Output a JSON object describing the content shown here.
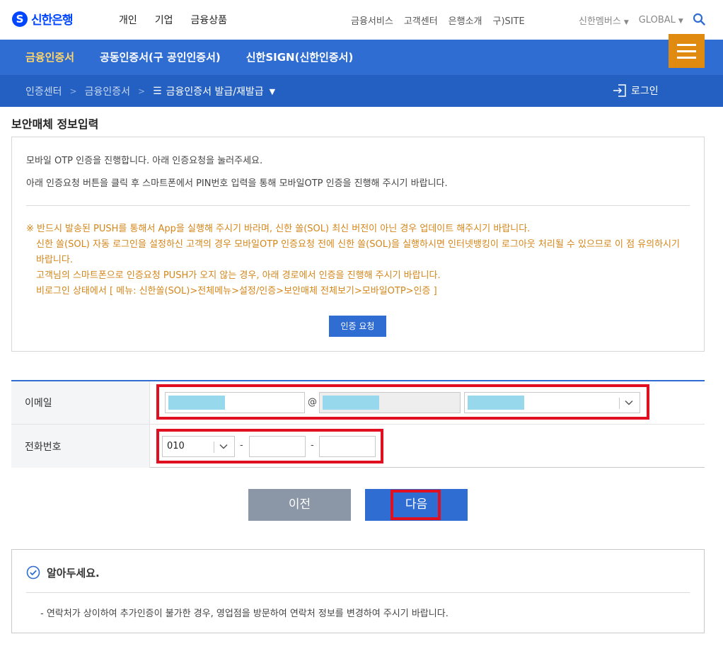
{
  "header": {
    "logo_mark": "S",
    "logo_text": "신한은행",
    "main_nav": [
      "개인",
      "기업",
      "금융상품"
    ],
    "util_nav": [
      "금융서비스",
      "고객센터",
      "은행소개",
      "구)SITE"
    ],
    "right_nav": [
      "신한멤버스",
      "GLOBAL"
    ]
  },
  "tabs": [
    "금융인증서",
    "공동인증서(구 공인인증서)",
    "신한SIGN(신한인증서)"
  ],
  "breadcrumb": {
    "items": [
      "인증센터",
      "금융인증서"
    ],
    "current": "금융인증서 발급/재발급",
    "login": "로그인"
  },
  "section_title": "보안매체 정보입력",
  "info": {
    "line1": "모바일 OTP 인증을 진행합니다. 아래 인증요청을 눌러주세요.",
    "line2": "아래 인증요청 버튼을 클릭 후 스마트폰에서 PIN번호 입력을 통해 모바일OTP 인증을 진행해 주시기 바랍니다.",
    "warn1": "※ 반드시 발송된 PUSH를 통해서 App을 실행해 주시기 바라며, 신한 쏠(SOL) 최신 버전이 아닌 경우 업데이트 해주시기 바랍니다.",
    "warn2": "신한 쏠(SOL) 자동 로그인을 설정하신 고객의 경우 모바일OTP 인증요청 전에 신한 쏠(SOL)을 실행하시면 인터넷뱅킹이 로그아웃 처리될 수 있으므로 이 점 유의하시기 바랍니다.",
    "warn3": "고객님의 스마트폰으로 인증요청 PUSH가 오지 않는 경우, 아래 경로에서 인증을 진행해 주시기 바랍니다.",
    "warn4": "비로그인 상태에서 [ 메뉴: 신한쏠(SOL)>전체메뉴>설정/인증>보안매체 전체보기>모바일OTP>인증 ]",
    "request_button": "인증 요청"
  },
  "form": {
    "email_label": "이메일",
    "at_sign": "@",
    "phone_label": "전화번호",
    "phone_prefix": "010",
    "dash": "-"
  },
  "buttons": {
    "prev": "이전",
    "next": "다음"
  },
  "notice": {
    "title": "알아두세요.",
    "text": "- 연락처가 상이하여 추가인증이 불가한 경우, 영업점을 방문하여 연락처 정보를 변경하여 주시기 바랍니다."
  },
  "colors": {
    "primary_blue": "#2f6dd2",
    "menu_orange": "#e08a10",
    "warning_orange": "#d4861a",
    "highlight_red": "#e01020",
    "masked_field": "#97d8ec"
  }
}
